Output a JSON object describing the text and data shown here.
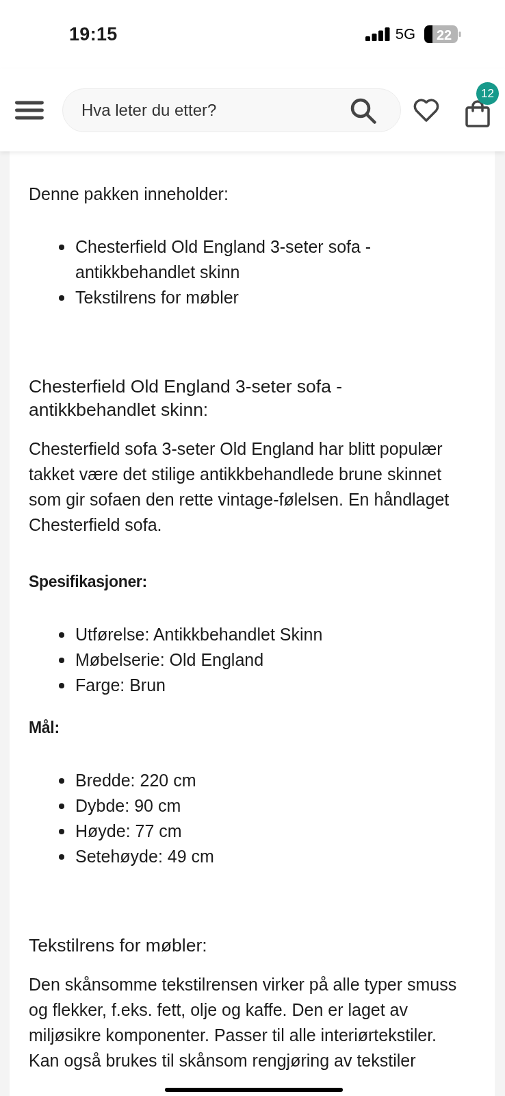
{
  "status_bar": {
    "time": "19:15",
    "network": "5G",
    "battery": "22"
  },
  "header": {
    "search": {
      "placeholder": "Hva leter du etter?"
    },
    "cart_badge": "12"
  },
  "content": [
    {
      "kind": "paragraph",
      "text": "Denne pakken inneholder:"
    },
    {
      "kind": "list",
      "items": [
        "Chesterfield Old England 3-seter sofa - antikkbehandlet skinn",
        "Tekstilrens for møbler"
      ]
    },
    {
      "kind": "heading",
      "text": "Chesterfield Old England 3-seter sofa - antikkbehandlet skinn:"
    },
    {
      "kind": "paragraph",
      "text": "Chesterfield sofa 3-seter Old England har blitt populær takket være det stilige antikkbehandlede brune skinnet som gir sofaen den rette vintage-følelsen. En håndlaget Chesterfield sofa."
    },
    {
      "kind": "label",
      "text": "Spesifikasjoner:"
    },
    {
      "kind": "list",
      "items": [
        "Utførelse: Antikkbehandlet Skinn",
        "Møbelserie: Old England",
        "Farge: Brun"
      ]
    },
    {
      "kind": "label",
      "text": "Mål:"
    },
    {
      "kind": "list",
      "items": [
        "Bredde: 220 cm",
        "Dybde: 90 cm",
        "Høyde: 77 cm",
        "Setehøyde: 49 cm"
      ]
    },
    {
      "kind": "heading",
      "text": "Tekstilrens for møbler:"
    },
    {
      "kind": "paragraph",
      "text": "Den skånsomme tekstilrensen virker på alle typer smuss og flekker, f.eks. fett, olje og kaffe. Den er laget av miljøsikre komponenter. Passer til alle interiørtekstiler. Kan også brukes til skånsom rengjøring av tekstiler"
    }
  ]
}
